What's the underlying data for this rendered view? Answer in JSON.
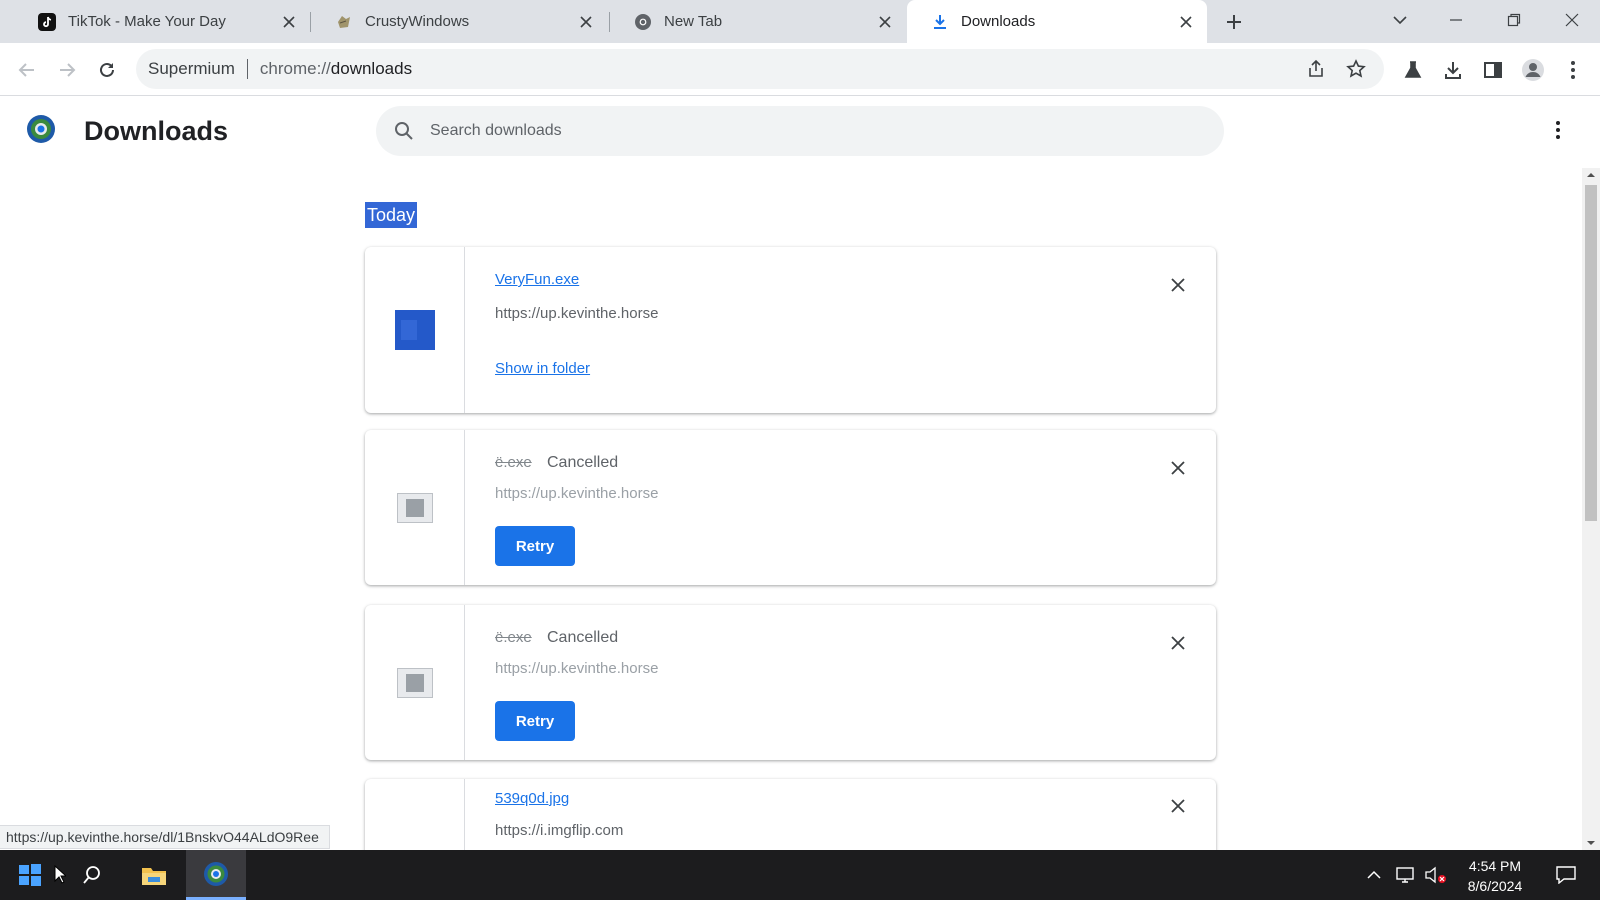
{
  "tabs": [
    {
      "title": "TikTok - Make Your Day",
      "icon": "tiktok-icon"
    },
    {
      "title": "CrustyWindows",
      "icon": "crustywindows-icon"
    },
    {
      "title": "New Tab",
      "icon": "chrome-icon"
    },
    {
      "title": "Downloads",
      "icon": "download-icon",
      "active": true
    }
  ],
  "toolbar": {
    "omnibox_site": "Supermium",
    "omnibox_scheme": "chrome://",
    "omnibox_path": "downloads"
  },
  "page": {
    "title": "Downloads",
    "search_placeholder": "Search downloads"
  },
  "downloads": {
    "date_label": "Today",
    "items": [
      {
        "filename": "VeryFun.exe",
        "url": "https://up.kevinthe.horse",
        "action": "Show in folder",
        "state": "complete"
      },
      {
        "filename": "ë.exe",
        "status": "Cancelled",
        "url": "https://up.kevinthe.horse",
        "action": "Retry",
        "state": "cancelled"
      },
      {
        "filename": "ë.exe",
        "status": "Cancelled",
        "url": "https://up.kevinthe.horse",
        "action": "Retry",
        "state": "cancelled"
      },
      {
        "filename": "539q0d.jpg",
        "url": "https://i.imgflip.com",
        "state": "complete"
      }
    ]
  },
  "status_bar": {
    "link_url": "https://up.kevinthe.horse/dl/1BnskvO44ALdO9Ree"
  },
  "taskbar": {
    "time": "4:54 PM",
    "date": "8/6/2024"
  },
  "colors": {
    "accent": "#1a73e8",
    "selection": "#3367d6",
    "tabstrip": "#dee1e6"
  }
}
